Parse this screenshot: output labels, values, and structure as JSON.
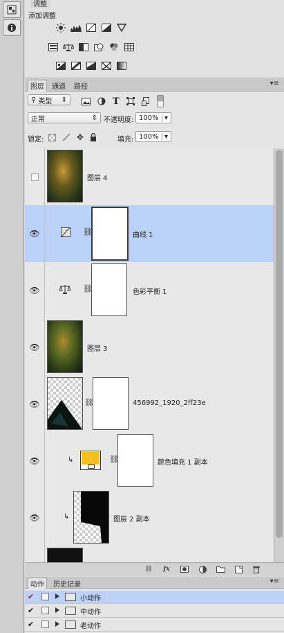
{
  "adjustments": {
    "tab_title": "调整",
    "heading": "添加调整",
    "row1_icons": [
      "brightness-icon",
      "levels-icon",
      "curves-icon",
      "exposure-icon",
      "vibrance-icon"
    ],
    "row2_icons": [
      "hue-saturation-icon",
      "color-balance-icon",
      "black-white-icon",
      "photo-filter-icon",
      "channel-mixer-icon",
      "color-lookup-icon"
    ],
    "row3_icons": [
      "invert-icon",
      "posterize-icon",
      "threshold-icon",
      "selective-color-icon",
      "gradient-map-icon"
    ]
  },
  "layers_panel": {
    "tabs": [
      "图层",
      "通道",
      "路径"
    ],
    "filter_kind": "类型",
    "blend_mode": "正常",
    "opacity_label": "不透明度:",
    "opacity_value": "100%",
    "lock_label": "锁定:",
    "fill_label": "填充:",
    "fill_value": "100%",
    "layers": [
      {
        "name": "图层 4",
        "visible": false,
        "selected": false
      },
      {
        "name": "曲线 1",
        "visible": true,
        "selected": true
      },
      {
        "name": "色彩平衡 1",
        "visible": true,
        "selected": false
      },
      {
        "name": "图层 3",
        "visible": true,
        "selected": false
      },
      {
        "name": "456992_1920_2ff23e",
        "visible": true,
        "selected": false
      },
      {
        "name": "颜色填充 1 副本",
        "visible": true,
        "selected": false
      },
      {
        "name": "图层 2 副本",
        "visible": true,
        "selected": false
      }
    ],
    "footer_icons": [
      "link-icon",
      "fx-icon",
      "mask-icon",
      "adjustment-icon",
      "group-folder-icon",
      "new-layer-icon",
      "trash-icon"
    ]
  },
  "actions_panel": {
    "tabs": [
      "动作",
      "历史记录"
    ],
    "items": [
      {
        "name": "小动作",
        "checked": true,
        "selected": true
      },
      {
        "name": "中动作",
        "checked": true,
        "selected": false
      },
      {
        "name": "老动作",
        "checked": true,
        "selected": false
      }
    ]
  },
  "colors": {
    "selection": "#bcd1f7",
    "fill_color_swatch": "#f4c020"
  }
}
